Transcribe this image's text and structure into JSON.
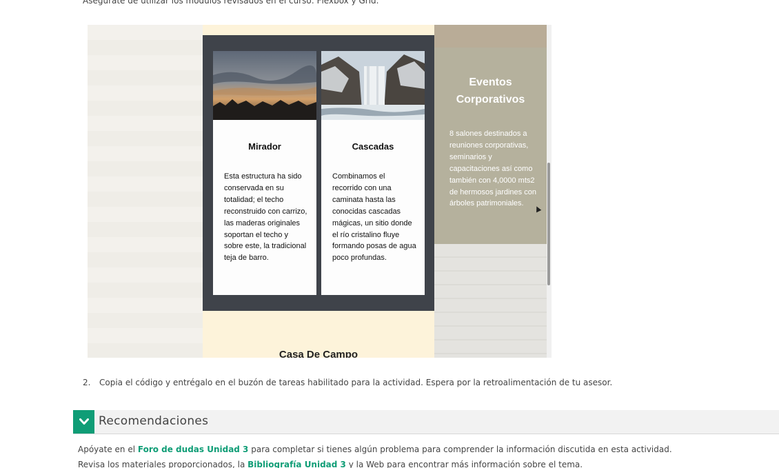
{
  "intro": {
    "text": "Asegúrate de utilizar los módulos revisados en el curso: Flexbox y Grid."
  },
  "screenshot": {
    "cards": [
      {
        "title": "Mirador",
        "text": "Esta estructura ha sido conservada en su totalidad; el techo reconstruido con carrizo, las maderas originales soportan el techo y sobre este, la tradicional teja de barro."
      },
      {
        "title": "Cascadas",
        "text": "Combinamos el recorrido con una caminata hasta las conocidas cascadas mágicas, un sitio donde el río cristalino fluye formando posas de agua poco profundas."
      }
    ],
    "side_panel": {
      "title": "Eventos Corporativos",
      "text": "8 salones destinados a reuniones corporativas, seminarios y capacitaciones así como también con 4,0000 mts2 de hermosos jardines con árboles patrimoniales."
    },
    "bottom_heading": "Casa De Campo"
  },
  "step2": {
    "number": "2.",
    "text": "Copia el código y entrégalo en el buzón de tareas habilitado para la actividad. Espera por la retroalimentación de tu asesor."
  },
  "recomendaciones": {
    "title": "Recomendaciones",
    "p1_before": "Apóyate en el ",
    "p1_link": "Foro de dudas Unidad 3",
    "p1_after": " para completar si tienes algún problema para comprender la información discutida en esta actividad.",
    "p2_before": "Revisa los materiales proporcionados, la ",
    "p2_link": "Bibliografía Unidad 3",
    "p2_after": " y la Web para encontrar más información sobre el tema."
  },
  "colors": {
    "accent": "#0f9d76",
    "card_frame": "#3f434a",
    "side_panel": "#b5b19d"
  }
}
